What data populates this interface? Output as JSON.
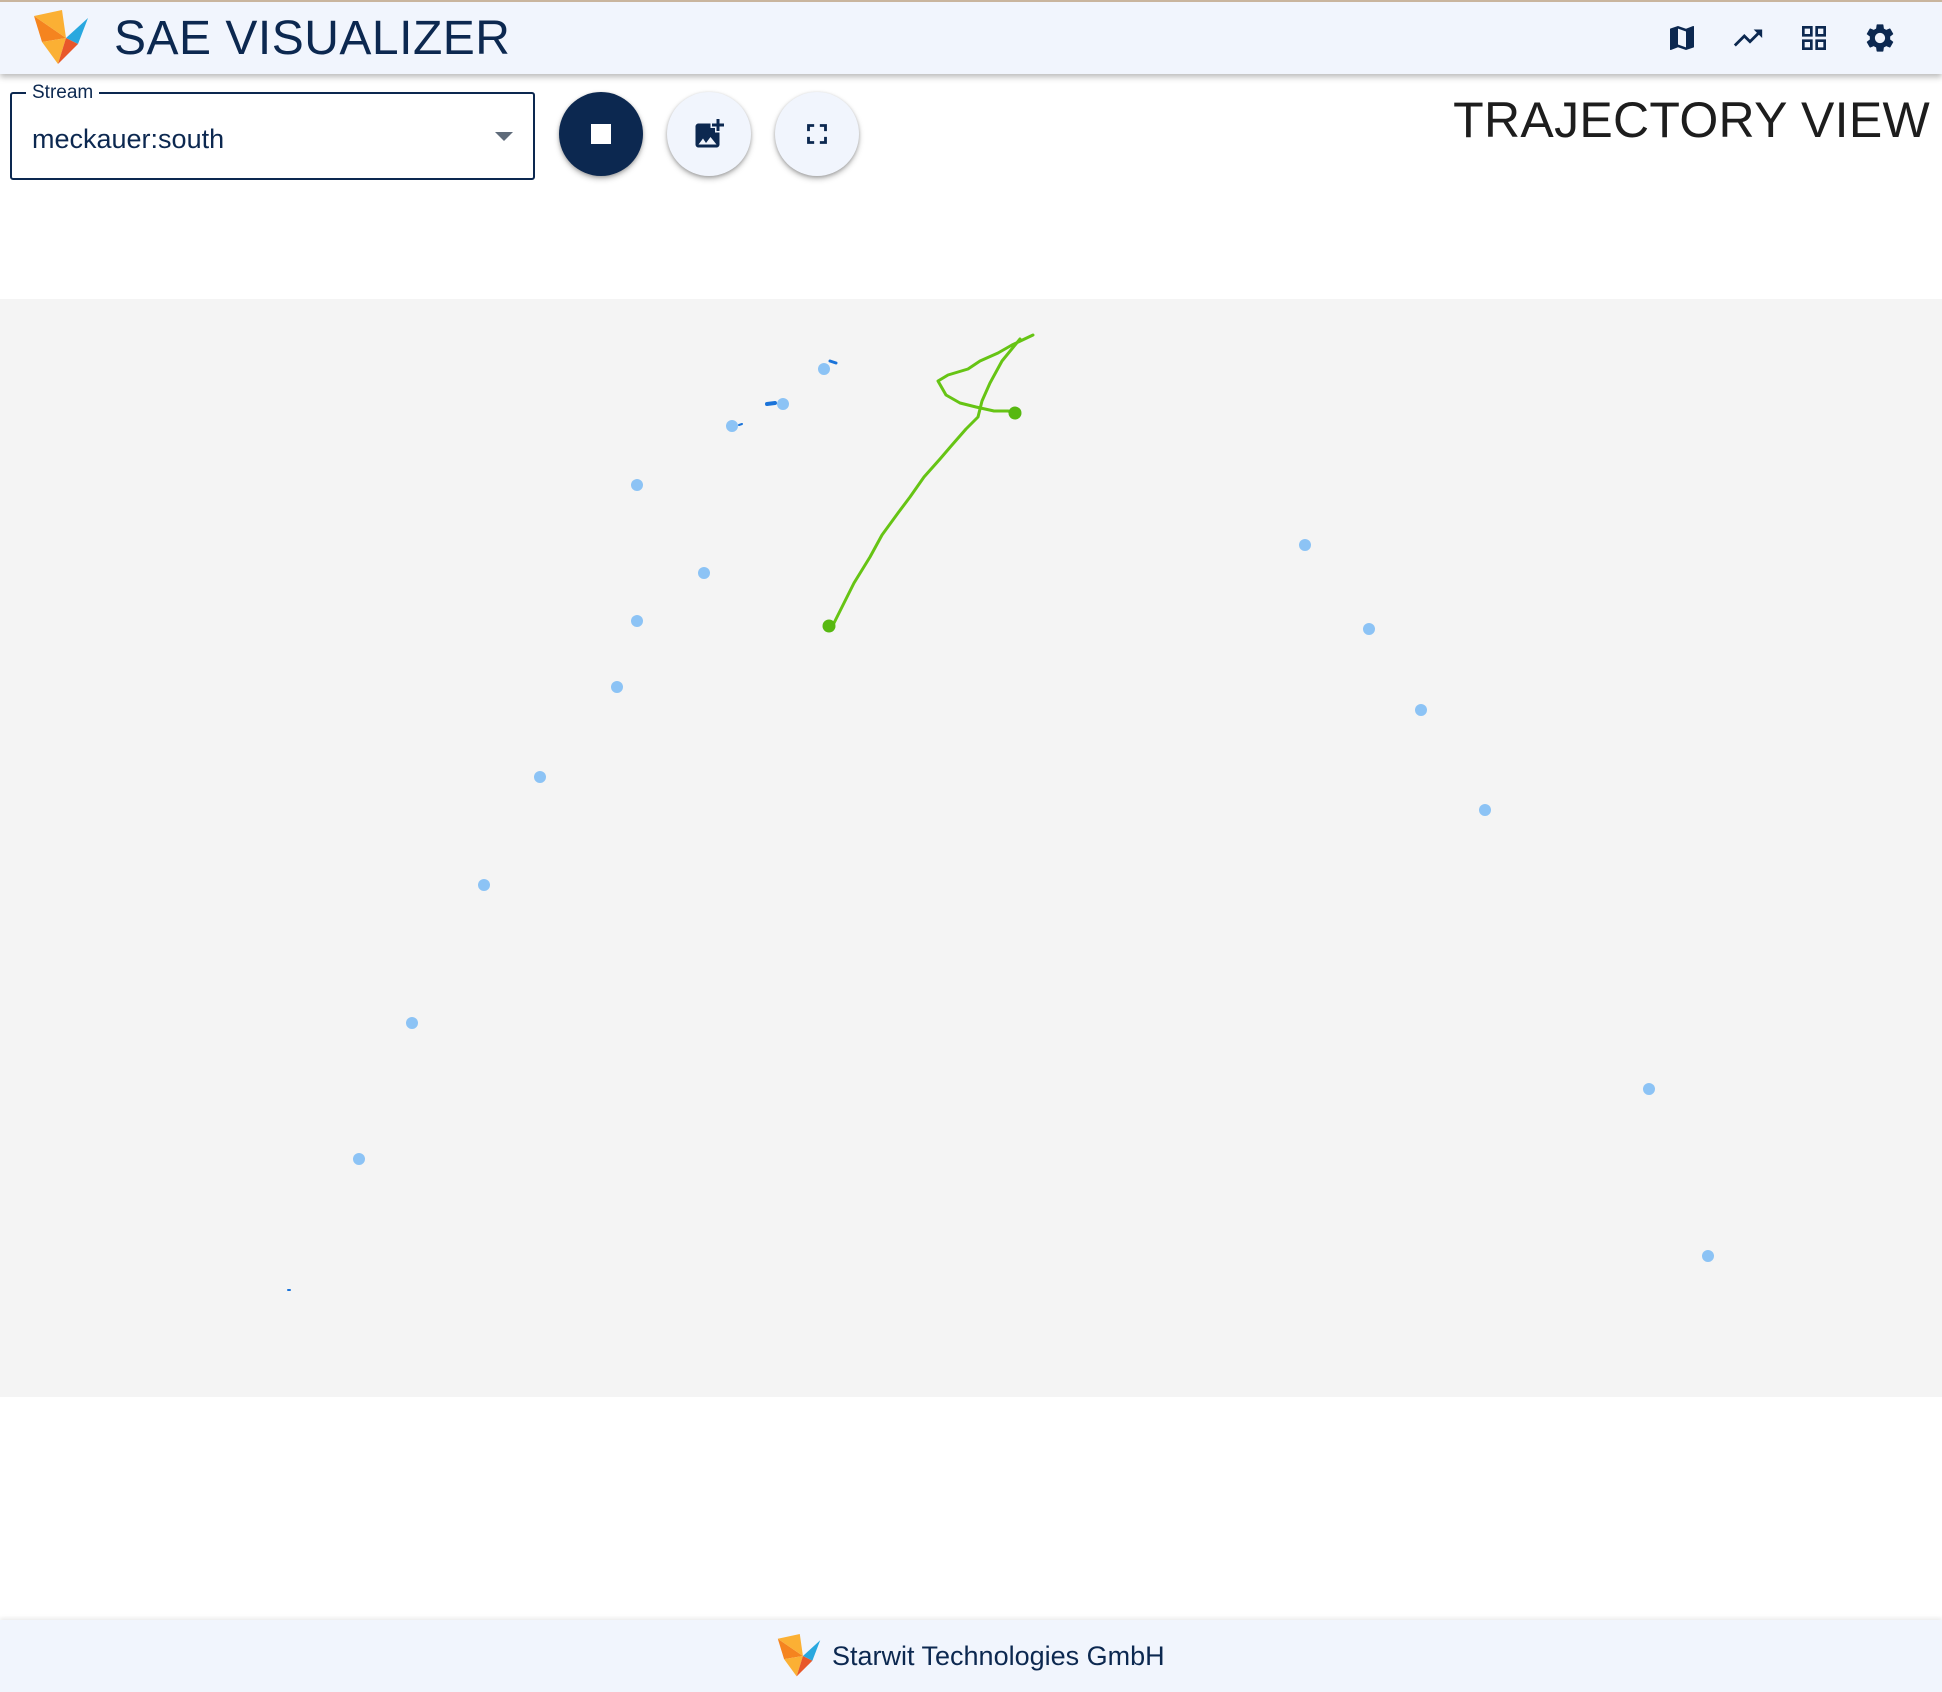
{
  "header": {
    "app_title": "SAE VISUALIZER",
    "logo_icon": "starwit-logo-icon",
    "nav_icons": [
      "map-icon",
      "trending-up-icon",
      "grid-view-icon",
      "settings-icon"
    ]
  },
  "toolbar": {
    "stream_label": "Stream",
    "stream_value": "meckauer:south",
    "stop_icon": "stop-icon",
    "add_photo_icon": "add-photo-icon",
    "fullscreen_icon": "fullscreen-icon"
  },
  "view_title": "TRAJECTORY VIEW",
  "trajectory": {
    "background_color": "#f4f4f4",
    "active_track_color": "#66c414",
    "detection_color": "#8cc3f5",
    "fragment_color": "#1a73d9"
  },
  "footer": {
    "company": "Starwit Technologies GmbH",
    "logo_icon": "starwit-logo-icon"
  },
  "colors": {
    "primary": "#0c2850",
    "bar_background": "#f1f5fd",
    "logo_orange": "#f5841f",
    "logo_yellow": "#fbb034",
    "logo_blue": "#29a8df"
  }
}
